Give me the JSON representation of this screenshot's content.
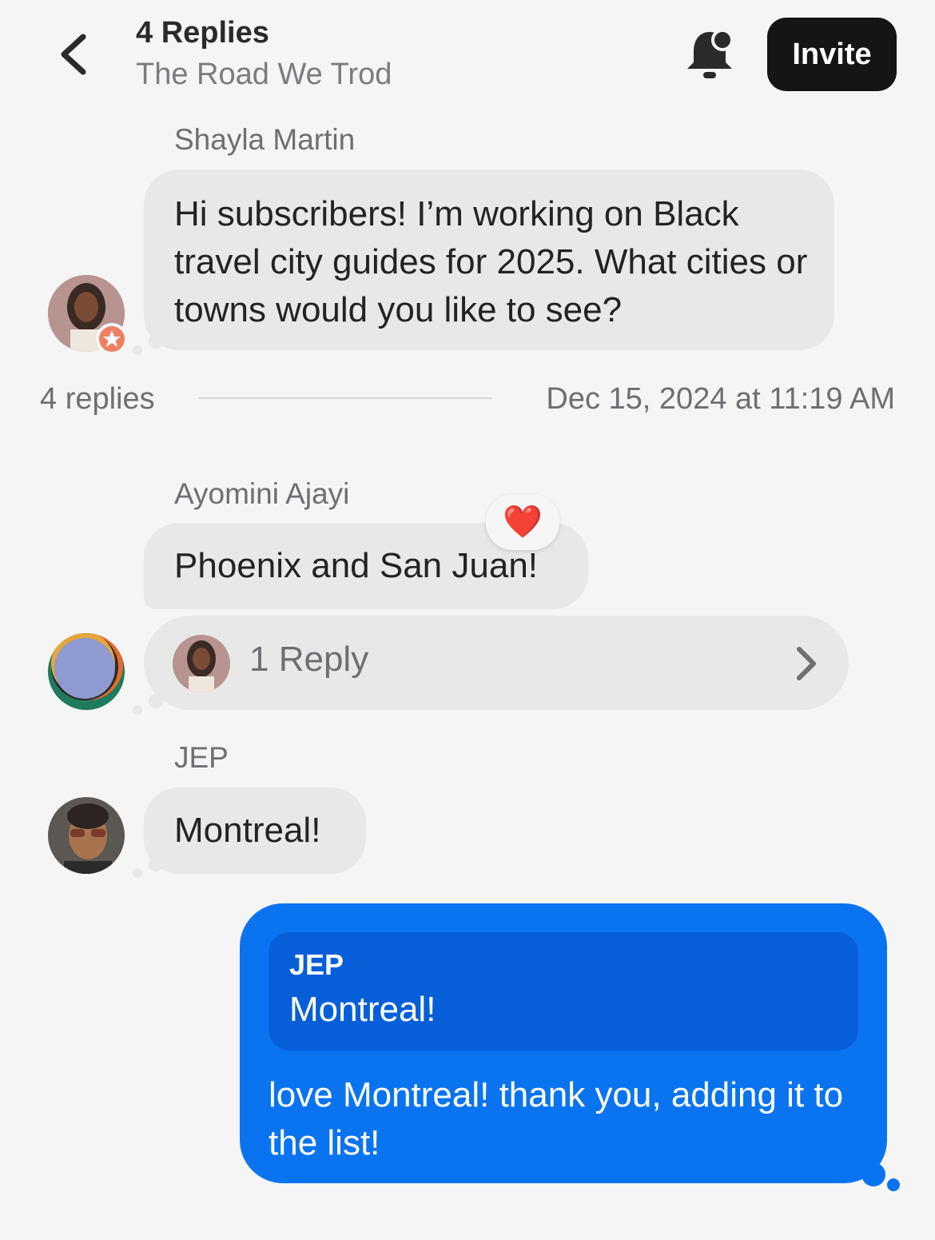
{
  "header": {
    "title": "4 Replies",
    "subtitle": "The Road We Trod",
    "invite_label": "Invite",
    "icons": [
      "back-chevron-icon",
      "bell-icon"
    ]
  },
  "messages": [
    {
      "author": "Shayla Martin",
      "text": "Hi subscribers! I’m working on Black travel city guides for 2025. What cities or towns would you like to see?"
    },
    {
      "author": "Ayomini Ajayi",
      "text": "Phoenix and San Juan!",
      "reaction": "❤️"
    },
    {
      "author": "JEP",
      "text": "Montreal!"
    }
  ],
  "thread_meta": {
    "replies_count": "4 replies",
    "timestamp": "Dec 15, 2024 at 11:19 AM"
  },
  "sub_thread": {
    "label": "1 Reply"
  },
  "own_reply": {
    "quoted_author": "JEP",
    "quoted_text": "Montreal!",
    "text": "love Montreal! thank you, adding it to the list!"
  },
  "colors": {
    "background": "#f5f5f5",
    "bubble_gray": "#e8e8e8",
    "bubble_blue": "#0a74f0",
    "quote_blue": "#065fd9",
    "invite_button": "#151516"
  }
}
